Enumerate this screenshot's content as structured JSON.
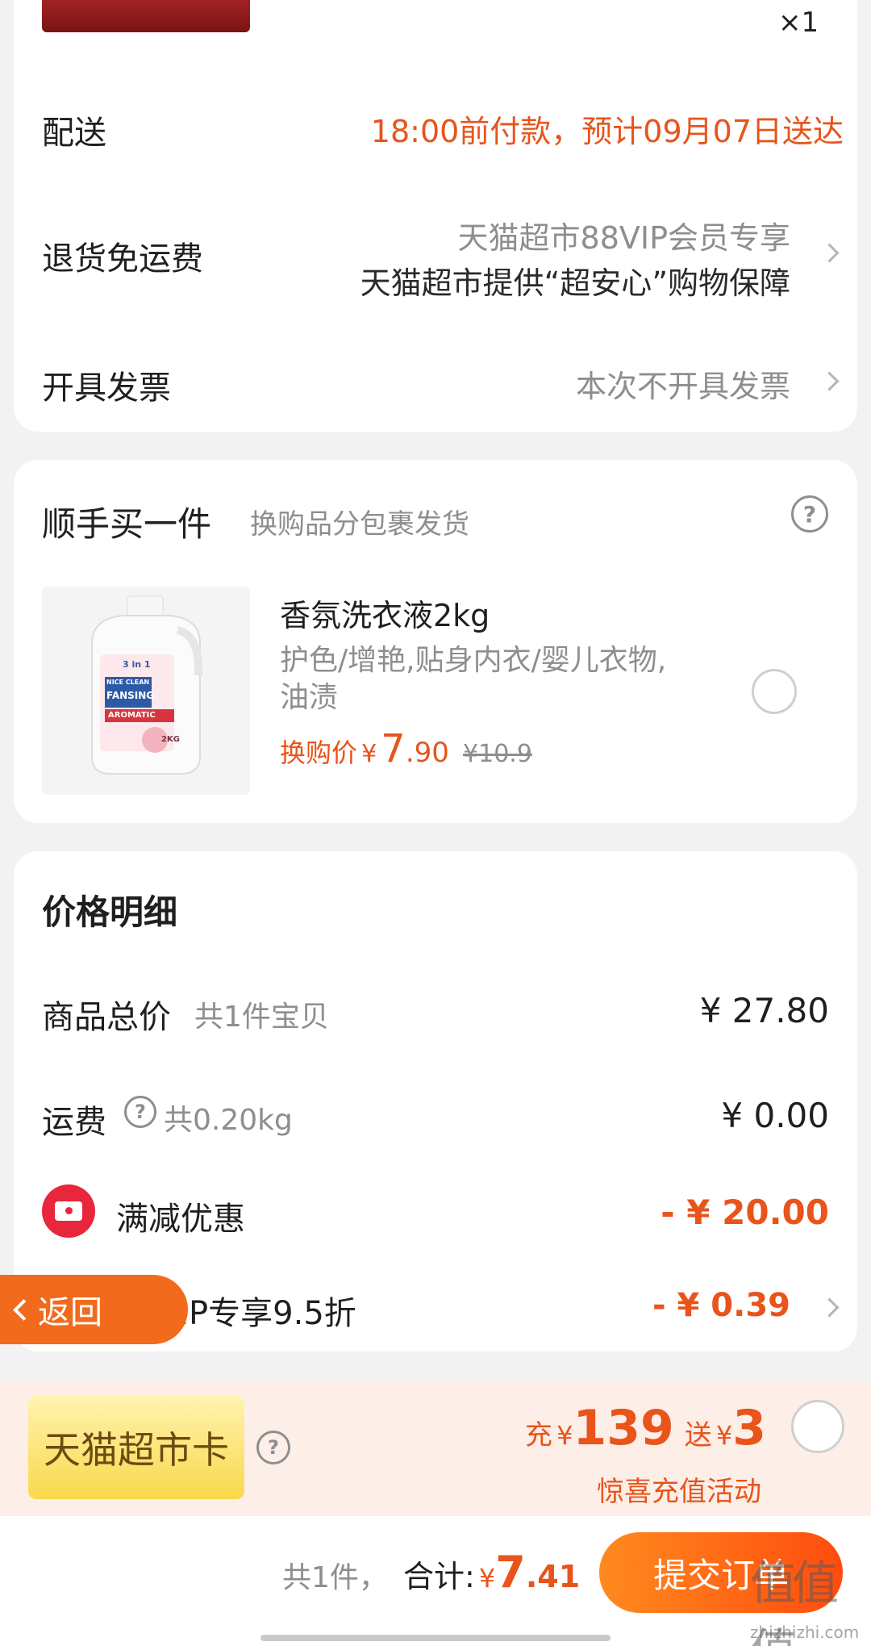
{
  "top": {
    "quantity_mark": "×1"
  },
  "delivery": {
    "label": "配送",
    "value": "18:00前付款，预计09月07日送达"
  },
  "return_shipping": {
    "label": "退货免运费",
    "line1": "天猫超市88VIP会员专享",
    "line2": "天猫超市提供“超安心”购物保障"
  },
  "invoice": {
    "label": "开具发票",
    "value": "本次不开具发票"
  },
  "addon": {
    "title": "顺手买一件",
    "subtitle": "换购品分包裹发货",
    "product": {
      "name": "香氛洗衣液2kg",
      "desc_line1": "护色/增艳,贴身内衣/婴儿衣物,",
      "desc_line2": "油渍",
      "price_prefix": "换购价",
      "currency": "¥",
      "price_int": "7",
      "price_dec": ".90",
      "original_price": "¥10.9",
      "bottle_brand_top": "NICE CLEAN",
      "bottle_brand": "FANSING",
      "bottle_tag": "AROMATIC",
      "bottle_badge": "3 in 1",
      "bottle_weight": "2KG"
    }
  },
  "price_detail": {
    "title": "价格明细",
    "goods_total_label": "商品总价",
    "goods_total_sub": "共1件宝贝",
    "goods_total_value": "¥ 27.80",
    "shipping_label": "运费",
    "shipping_sub": "共0.20kg",
    "shipping_value": "¥ 0.00",
    "discount_label": "满减优惠",
    "discount_value": "- ¥ 20.00",
    "vip_label": "88VIP专享9.5折",
    "vip_value": "- ¥ 0.39"
  },
  "back_button": {
    "label": "返回"
  },
  "tmall_card": {
    "label": "天猫超市卡",
    "recharge_prefix": "充",
    "currency": "¥",
    "recharge_amount": "139",
    "gift_prefix": "送",
    "gift_amount": "3",
    "activity": "惊喜充值活动"
  },
  "bottom_bar": {
    "count": "共1件，",
    "total_label": "合计:",
    "currency": "¥",
    "total_int": "7",
    "total_dec": ".41",
    "submit": "提交订单"
  },
  "watermark": {
    "text": "值",
    "site": "zhizhizhi.com"
  },
  "colors": {
    "accent": "#e8541a",
    "gray": "#8e8e8e",
    "card_bg": "#ffffff",
    "page_bg": "#f2f2f2"
  }
}
